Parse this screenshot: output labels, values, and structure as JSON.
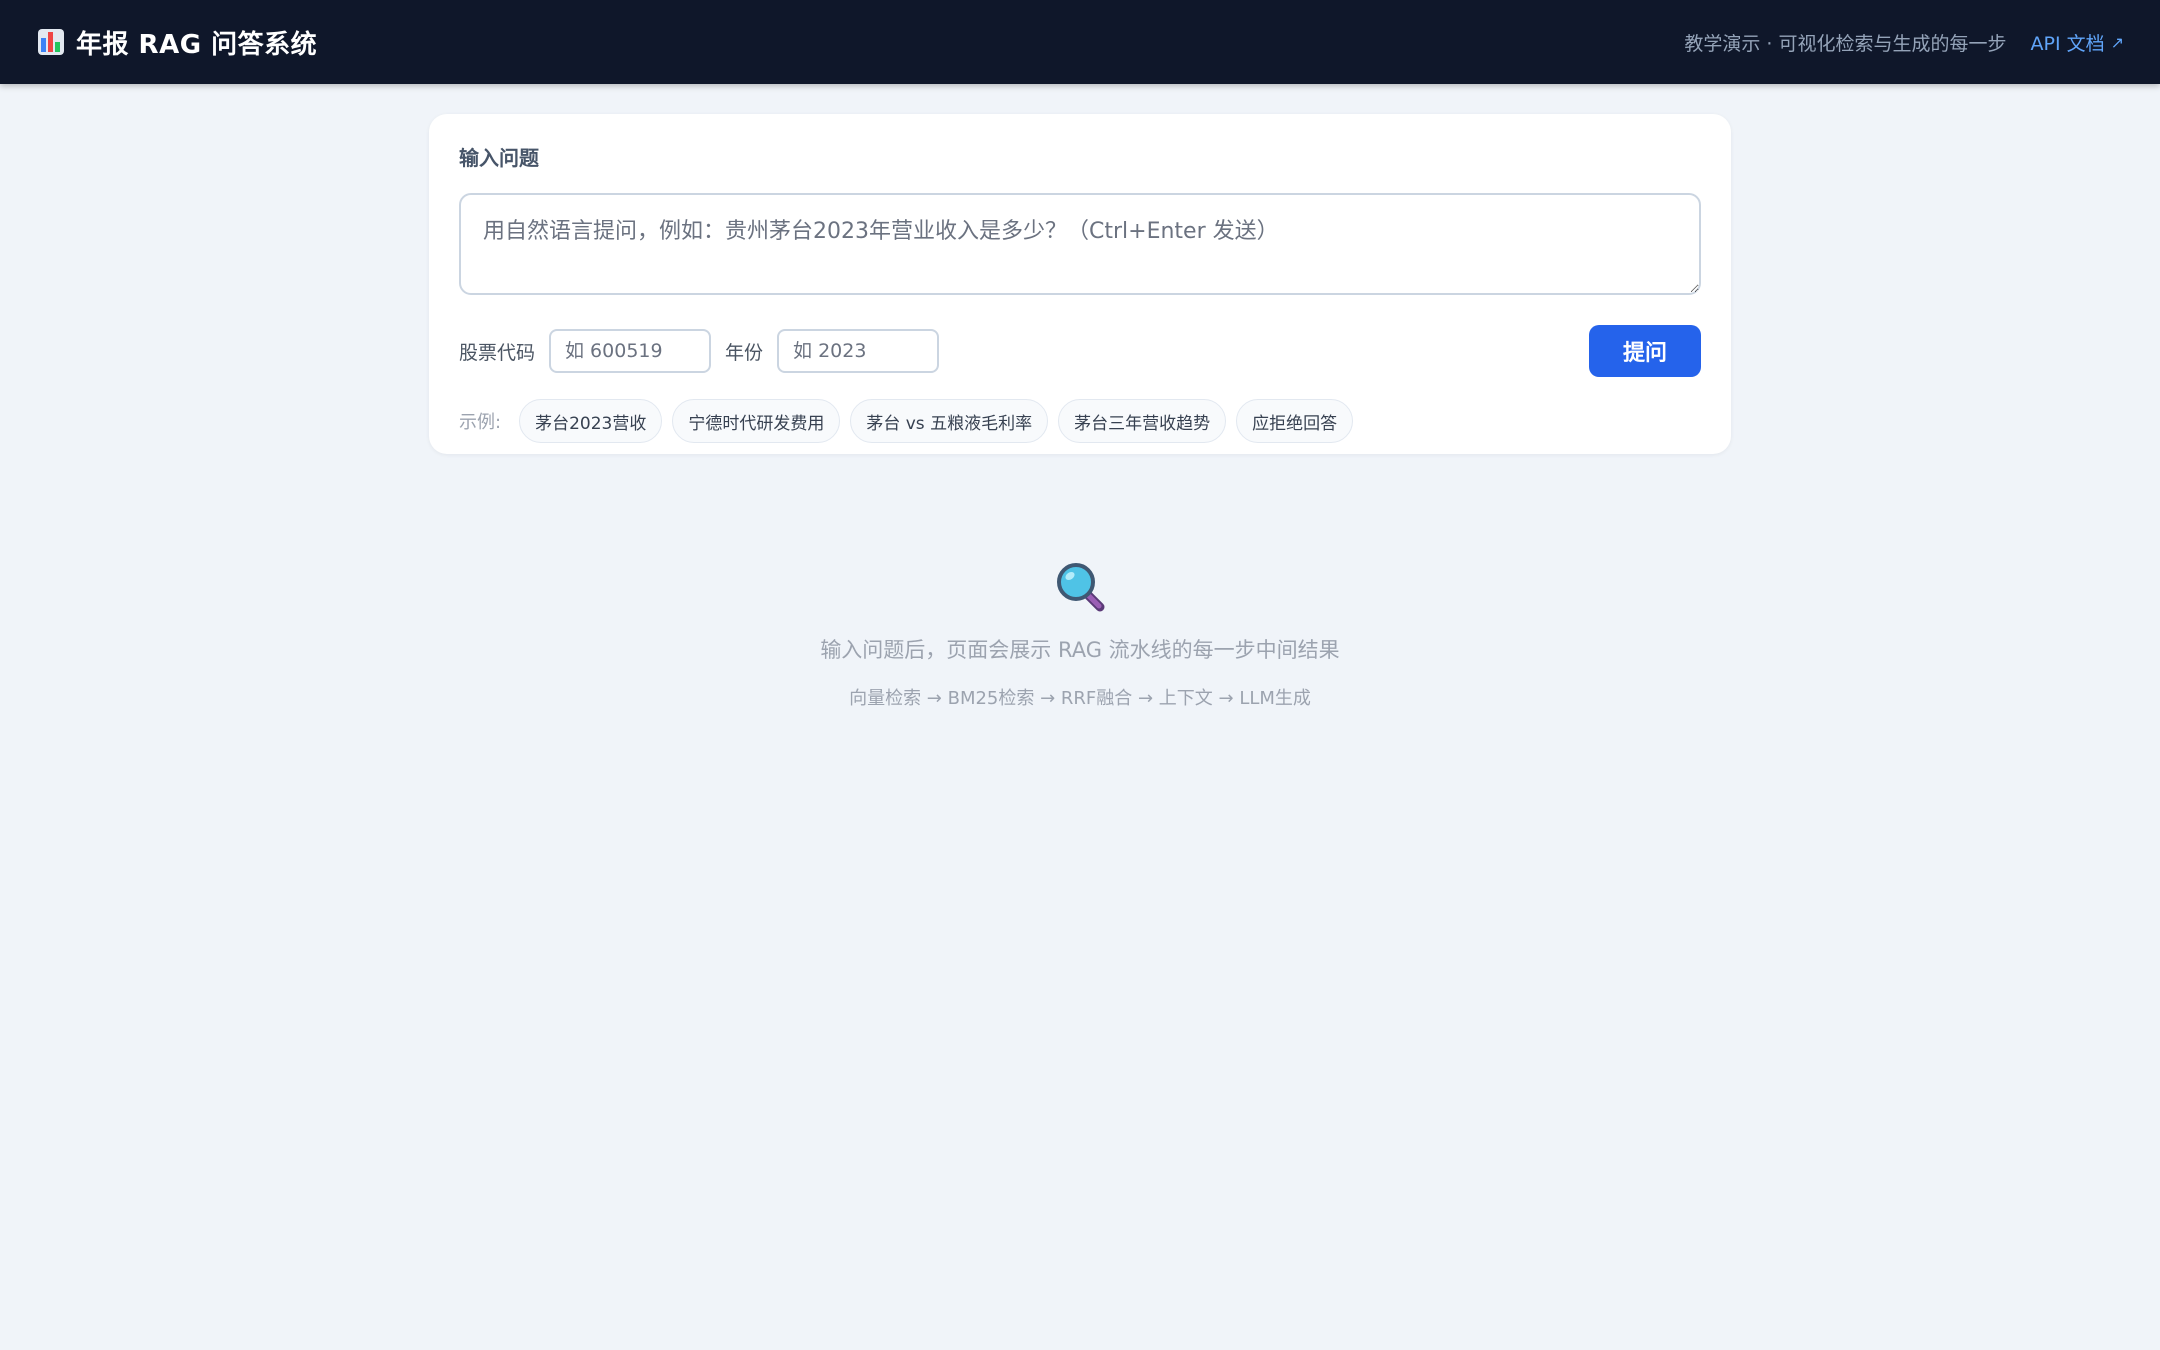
{
  "header": {
    "title": "年报 RAG 问答系统",
    "tagline": "教学演示 · 可视化检索与生成的每一步",
    "api_link": "API 文档",
    "api_arrow": "↗"
  },
  "query_card": {
    "label": "输入问题",
    "question_placeholder": "用自然语言提问，例如：贵州茅台2023年营业收入是多少？（Ctrl+Enter 发送）",
    "stock_code_label": "股票代码",
    "stock_code_placeholder": "如 600519",
    "year_label": "年份",
    "year_placeholder": "如 2023",
    "ask_button": "提问",
    "examples_label": "示例:",
    "examples": [
      "茅台2023营收",
      "宁德时代研发费用",
      "茅台 vs 五粮液毛利率",
      "茅台三年营收趋势",
      "应拒绝回答"
    ]
  },
  "empty_state": {
    "icon": "magnifier-icon",
    "message": "输入问题后，页面会展示 RAG 流水线的每一步中间结果",
    "pipeline": "向量检索 → BM25检索 → RRF融合 → 上下文 → LLM生成"
  },
  "colors": {
    "header_bg": "#0f172a",
    "page_bg": "#f0f4f9",
    "accent": "#2563eb",
    "link": "#60a5fa"
  }
}
